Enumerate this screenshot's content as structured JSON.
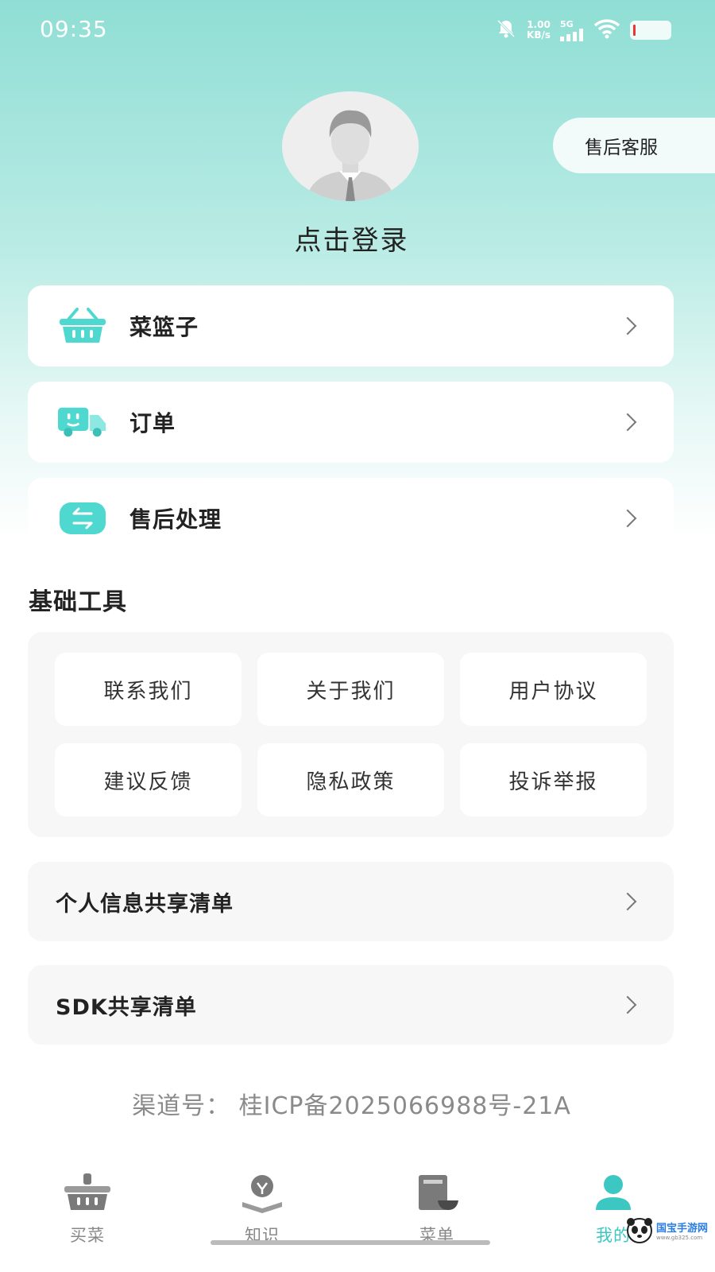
{
  "status_bar": {
    "time": "09:35",
    "net_speed_value": "1.00",
    "net_speed_unit": "KB/s",
    "network": "5G"
  },
  "profile": {
    "login_text": "点击登录"
  },
  "service_button": "售后客服",
  "menu": [
    {
      "label": "菜篮子",
      "icon": "basket-icon"
    },
    {
      "label": "订单",
      "icon": "truck-icon"
    },
    {
      "label": "售后处理",
      "icon": "exchange-icon"
    }
  ],
  "tools": {
    "title": "基础工具",
    "items": [
      "联系我们",
      "关于我们",
      "用户协议",
      "建议反馈",
      "隐私政策",
      "投诉举报"
    ]
  },
  "lists": [
    {
      "label": "个人信息共享清单"
    },
    {
      "label": "SDK共享清单"
    }
  ],
  "channel_text": "渠道号：  桂ICP备2025066988号-21A",
  "tabbar": {
    "items": [
      {
        "label": "买菜",
        "icon": "basket-icon"
      },
      {
        "label": "知识",
        "icon": "bulb-book-icon"
      },
      {
        "label": "菜单",
        "icon": "menu-book-icon"
      },
      {
        "label": "我的",
        "icon": "user-icon"
      }
    ],
    "active_index": 3
  },
  "watermark": {
    "text": "国宝手游网",
    "sub": "www.gb325.com"
  },
  "colors": {
    "accent": "#3cc7c2",
    "header_gradient_top": "#8fded5",
    "icon_teal": "#4fd8cf"
  }
}
